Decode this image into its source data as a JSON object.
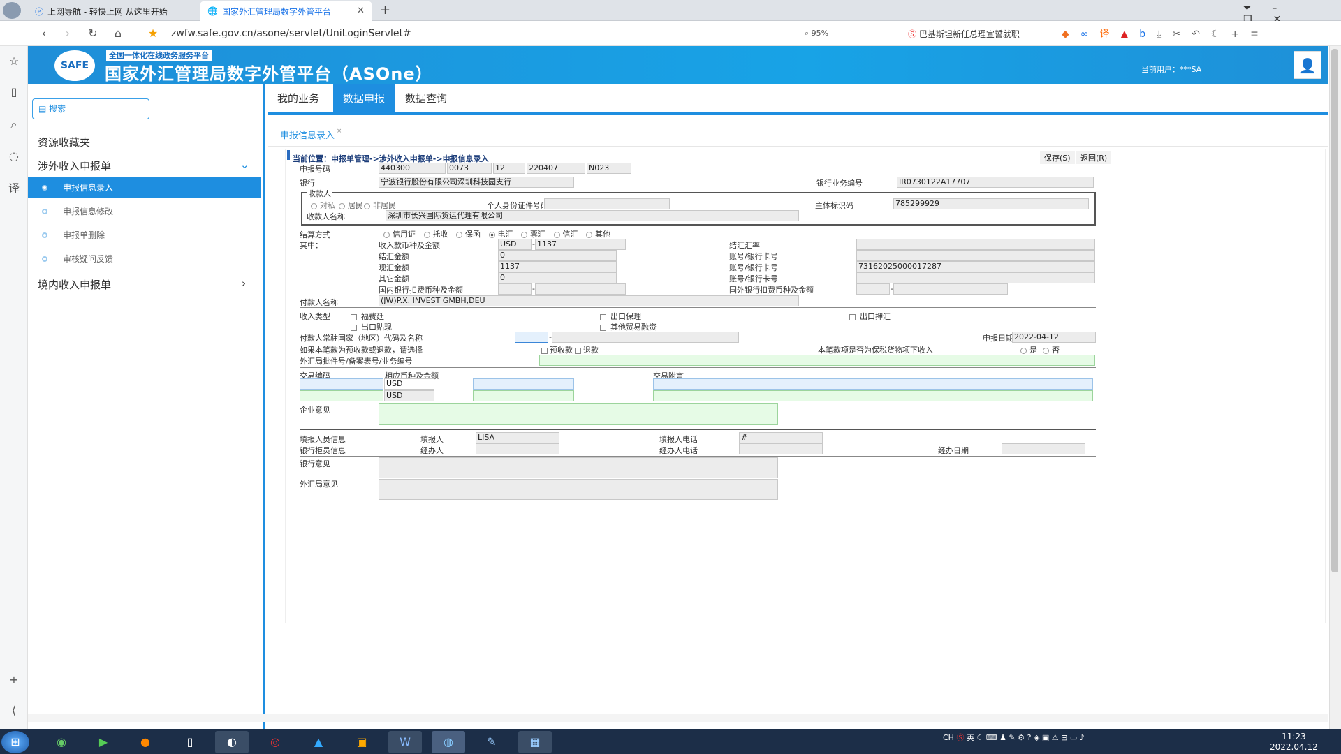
{
  "browser": {
    "tabs": [
      {
        "label": "上网导航 - 轻快上网 从这里开始"
      },
      {
        "label": "国家外汇管理局数字外管平台"
      }
    ],
    "url": "zwfw.safe.gov.cn/asone/servlet/UniLoginServlet#",
    "zoom": "95%",
    "news": "巴基斯坦新任总理宣誓就职"
  },
  "banner": {
    "logo": "SAFE",
    "tagline": "全国一体化在线政务服务平台",
    "title": "国家外汇管理局数字外管平台（ASOne）",
    "current_user": "当前用户：***SA"
  },
  "leftnav": {
    "search_placeholder": "搜索",
    "favorites": "资源收藏夹",
    "group1": "涉外收入申报单",
    "items": [
      "申报信息录入",
      "申报信息修改",
      "申报单删除",
      "审核疑问反馈"
    ],
    "group2": "境内收入申报单"
  },
  "topnav": {
    "tabs": [
      "我的业务",
      "数据申报",
      "数据查询"
    ]
  },
  "subtab": "申报信息录入",
  "form": {
    "breadcrumb": "当前位置：申报单管理->涉外收入申报单->申报信息录入",
    "save": "保存(S)",
    "back": "返回(R)",
    "report_no_label": "申报号码",
    "report_no": [
      "440300",
      "0073",
      "12",
      "220407",
      "N023"
    ],
    "bank_label": "银行",
    "bank": "宁波银行股份有限公司深圳科技园支行",
    "bank_biz_label": "银行业务编号",
    "bank_biz": "IR0730122A17707",
    "payee_group": "收款人",
    "payee_types": [
      "对私",
      "居民",
      "非居民"
    ],
    "id_label": "个人身份证件号码",
    "subject_label": "主体标识码",
    "subject": "785299929",
    "payee_name_label": "收款人名称",
    "payee_name": "深圳市长兴国际货运代理有限公司",
    "settle_label": "结算方式",
    "settle_opts": [
      "信用证",
      "托收",
      "保函",
      "电汇",
      "票汇",
      "信汇",
      "其他"
    ],
    "among_label": "其中：",
    "currency_amount_label": "收入款币种及金额",
    "currency": "USD",
    "amount": "1137",
    "fx_rate_label": "结汇汇率",
    "settle_amt_label": "结汇金额",
    "settle_amt": "0",
    "spot_amt_label": "现汇金额",
    "spot_amt": "1137",
    "other_amt_label": "其它金额",
    "other_amt": "0",
    "account_label": "账号/银行卡号",
    "account": "73162025000017287",
    "dom_fee_label": "国内银行扣费币种及金额",
    "for_fee_label": "国外银行扣费币种及金额",
    "payer_label": "付款人名称",
    "payer": "(JW)P.X. INVEST GMBH,DEU",
    "income_type_label": "收入类型",
    "income_types": [
      "福费廷",
      "出口保理",
      "出口押汇",
      "出口贴现",
      "其他贸易融资"
    ],
    "country_label": "付款人常驻国家（地区）代码及名称",
    "report_date_label": "申报日期",
    "report_date": "2022-04-12",
    "prepay_label": "如果本笔款为预收款或退款，请选择",
    "prepay_opts": [
      "预收款",
      "退款"
    ],
    "bonded_label": "本笔款项是否为保税货物项下收入",
    "yesno": [
      "是",
      "否"
    ],
    "approval_label": "外汇局批件号/备案表号/业务编号",
    "tx_code_label": "交易编码",
    "tx_currency_label": "相应币种及金额",
    "tx_ccy1": "USD",
    "tx_ccy2": "USD",
    "tx_note_label": "交易附言",
    "comment_label": "企业意见",
    "filler_info_label": "填报人员信息",
    "filler_label": "填报人",
    "filler": "LISA",
    "filler_tel_label": "填报人电话",
    "filler_tel": "#",
    "bank_staff_label": "银行柜员信息",
    "handler_label": "经办人",
    "handler_tel_label": "经办人电话",
    "handle_date_label": "经办日期",
    "bank_comment_label": "银行意见",
    "fx_comment_label": "外汇局意见"
  },
  "tray": {
    "lang": "CH",
    "ime": "英",
    "time": "11:23",
    "date": "2022.04.12"
  }
}
